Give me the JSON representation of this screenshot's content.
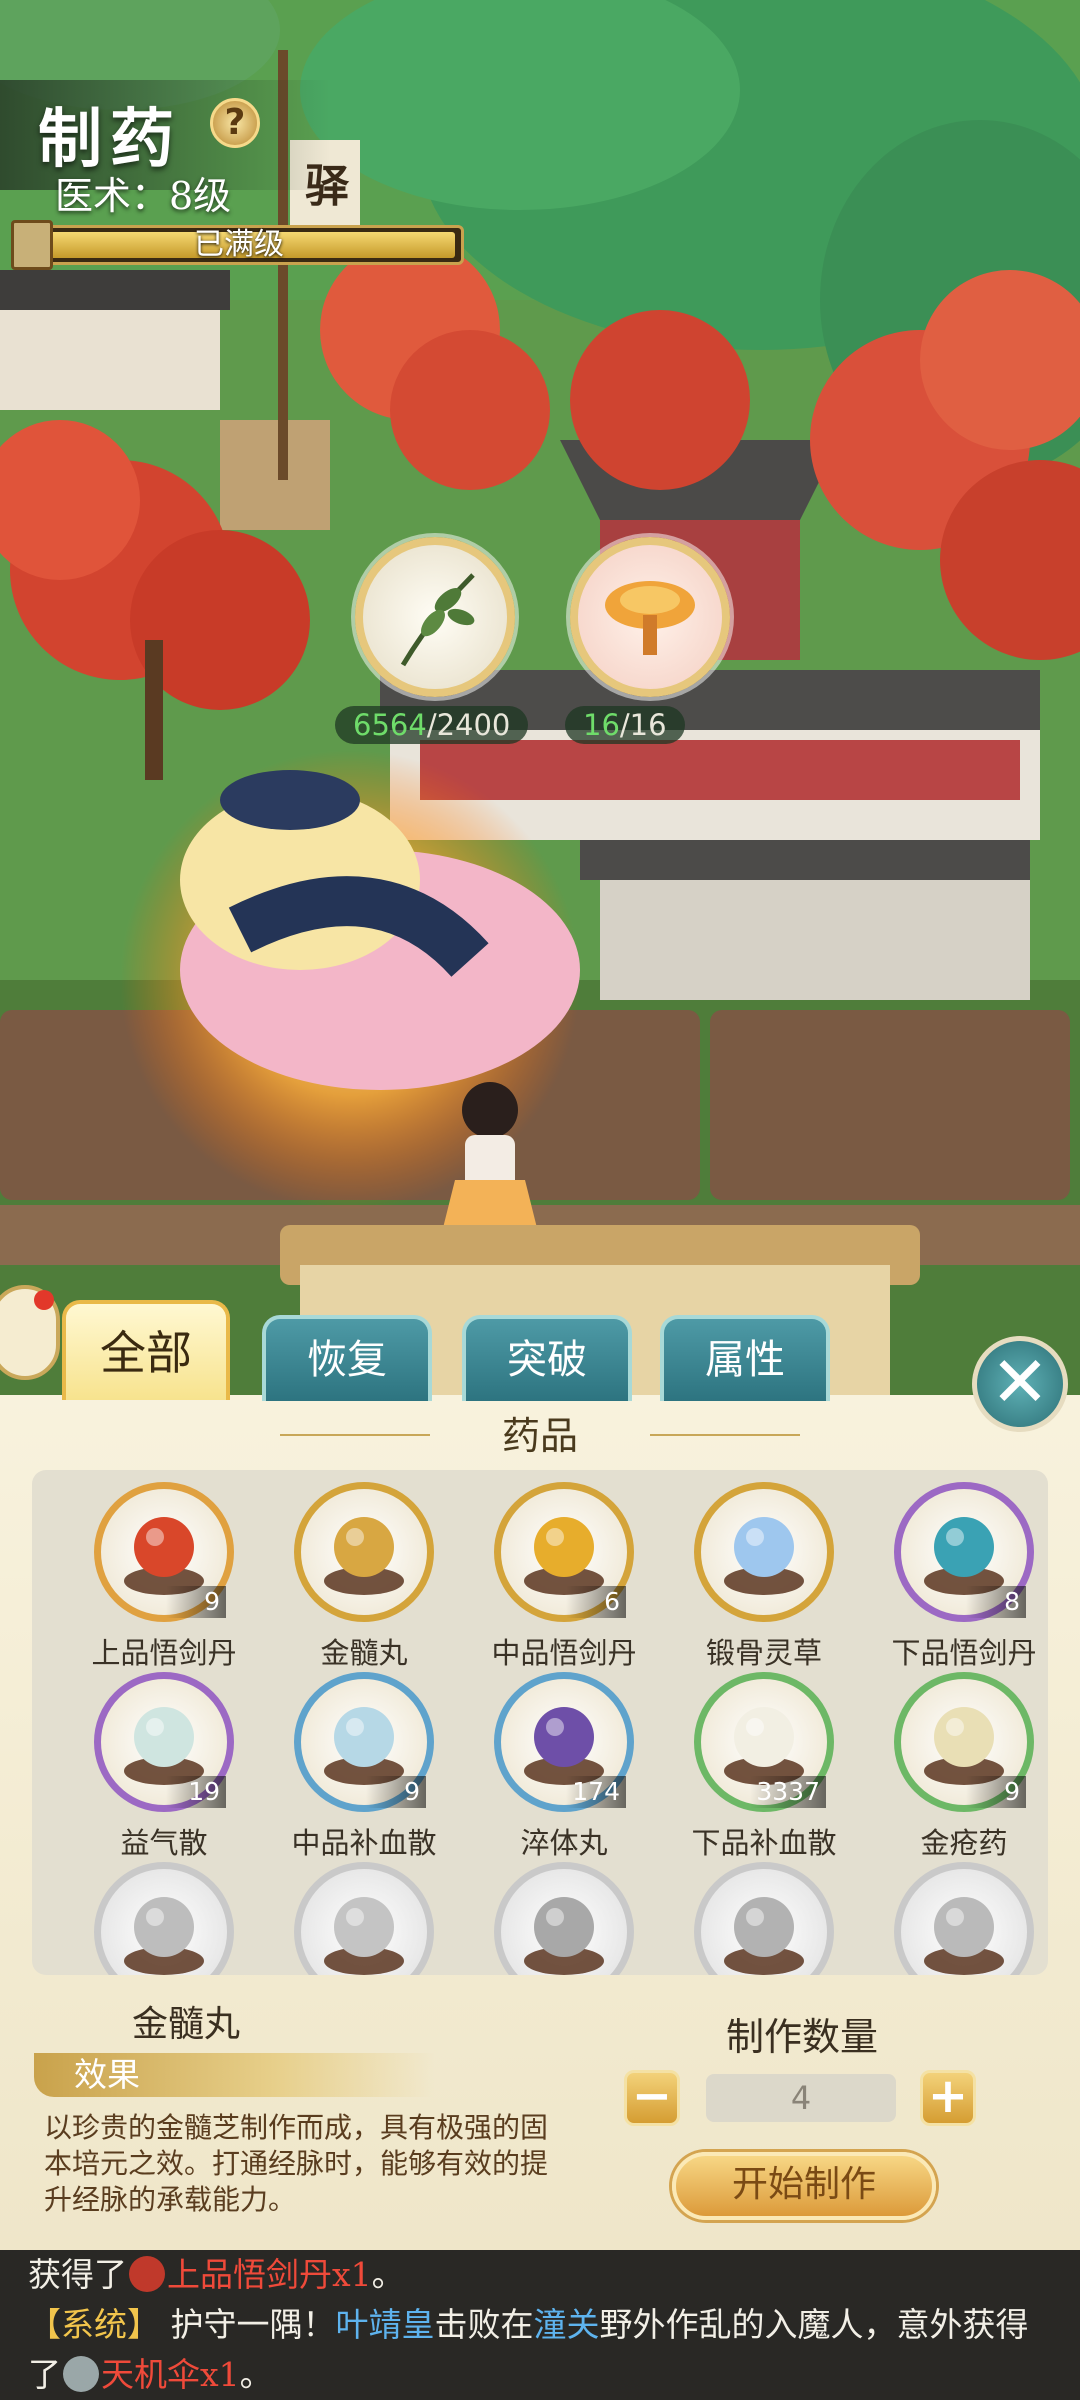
{
  "hud": {
    "title": "制药",
    "help": "?",
    "level": "医术：8级",
    "bar_text": "已满级",
    "bar_progress": 1.0,
    "sign_char": "驿"
  },
  "resources": [
    {
      "icon": "herb-leaf-icon",
      "have": "6564",
      "need": "/2400"
    },
    {
      "icon": "lingzhi-mushroom-icon",
      "have": "16",
      "need": "/16"
    }
  ],
  "tabs": [
    {
      "label": "全部",
      "active": true
    },
    {
      "label": "恢复",
      "active": false
    },
    {
      "label": "突破",
      "active": false
    },
    {
      "label": "属性",
      "active": false
    }
  ],
  "section_title": "药品",
  "items": [
    {
      "name": "上品悟剑丹",
      "count": "9",
      "icon": "red-orb-pill-icon",
      "frame": "orange"
    },
    {
      "name": "金髓丸",
      "count": "",
      "icon": "gold-pill-box-icon",
      "frame": "gold"
    },
    {
      "name": "中品悟剑丹",
      "count": "6",
      "icon": "gold-orb-pill-icon",
      "frame": "gold"
    },
    {
      "name": "锻骨灵草",
      "count": "",
      "icon": "blue-flower-icon",
      "frame": "gold"
    },
    {
      "name": "下品悟剑丹",
      "count": "8",
      "icon": "teal-orb-pill-icon",
      "frame": "purple"
    },
    {
      "name": "益气散",
      "count": "19",
      "icon": "vase-pills-icon",
      "frame": "purple"
    },
    {
      "name": "中品补血散",
      "count": "9",
      "icon": "blue-powder-icon",
      "frame": "blue"
    },
    {
      "name": "淬体丸",
      "count": "174",
      "icon": "purple-pill-box-icon",
      "frame": "blue"
    },
    {
      "name": "下品补血散",
      "count": "3337",
      "icon": "white-powder-icon",
      "frame": "green"
    },
    {
      "name": "金疮药",
      "count": "9",
      "icon": "powder-vase-icon",
      "frame": "green"
    },
    {
      "name": "",
      "count": "",
      "icon": "gourd-bottle-icon",
      "frame": "gray"
    },
    {
      "name": "",
      "count": "",
      "icon": "gourd-icon",
      "frame": "gray"
    },
    {
      "name": "",
      "count": "",
      "icon": "jar-icon",
      "frame": "gray"
    },
    {
      "name": "",
      "count": "",
      "icon": "pills-plate-icon",
      "frame": "gray"
    },
    {
      "name": "",
      "count": "",
      "icon": "vase-icon",
      "frame": "gray"
    }
  ],
  "detail": {
    "name": "金髓丸",
    "effect_label": "效果",
    "description": "以珍贵的金髓芝制作而成，具有极强的固本培元之效。打通经脉时，能够有效的提升经脉的承载能力。"
  },
  "quantity": {
    "label": "制作数量",
    "minus": "−",
    "plus": "+",
    "value": "4",
    "start_button": "开始制作"
  },
  "log": {
    "l1_a": "获得了",
    "l1_item": "上品悟剑丹x1",
    "l1_end": "。",
    "l2_tag": "【系统】",
    "l2_a": " 护守一隅！",
    "l2_name": "叶靖皇",
    "l2_b": "击败在",
    "l2_place": "潼关",
    "l2_c": "野外作乱的入魔人，意外获得",
    "l3_a": "了",
    "l3_item": "天机伞x1",
    "l3_end": "。"
  }
}
